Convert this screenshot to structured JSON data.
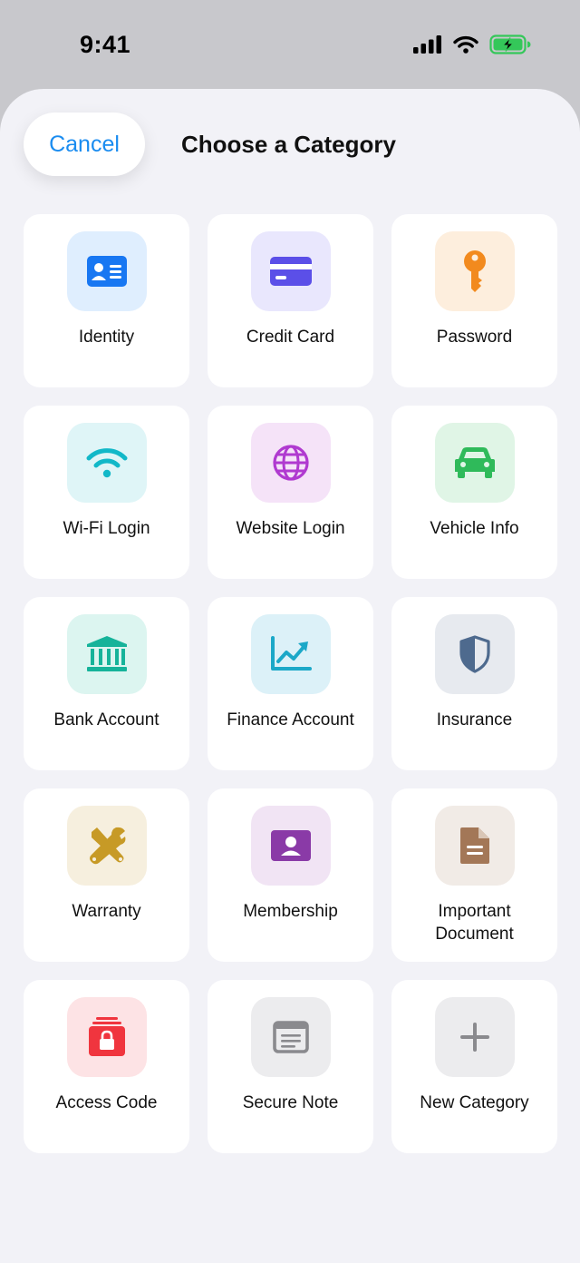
{
  "status": {
    "time": "9:41"
  },
  "header": {
    "cancel_label": "Cancel",
    "title": "Choose a Category"
  },
  "categories": [
    {
      "label": "Identity",
      "icon": "id-card-icon",
      "bg": "#dfeefe",
      "color": "#1877f2"
    },
    {
      "label": "Credit Card",
      "icon": "credit-card-icon",
      "bg": "#e9e7fd",
      "color": "#5b4fe8"
    },
    {
      "label": "Password",
      "icon": "key-icon",
      "bg": "#fdeedd",
      "color": "#f28a1e"
    },
    {
      "label": "Wi-Fi Login",
      "icon": "wifi-icon",
      "bg": "#dff5f7",
      "color": "#12b8c8"
    },
    {
      "label": "Website Login",
      "icon": "globe-icon",
      "bg": "#f5e3f8",
      "color": "#b03ad0"
    },
    {
      "label": "Vehicle Info",
      "icon": "car-icon",
      "bg": "#e0f5e6",
      "color": "#2fba5a"
    },
    {
      "label": "Bank Account",
      "icon": "bank-icon",
      "bg": "#dcf5f0",
      "color": "#16b39a"
    },
    {
      "label": "Finance Account",
      "icon": "chart-icon",
      "bg": "#dcf1f8",
      "color": "#1ba8c8"
    },
    {
      "label": "Insurance",
      "icon": "shield-icon",
      "bg": "#e7eaef",
      "color": "#4e6a8e"
    },
    {
      "label": "Warranty",
      "icon": "tools-icon",
      "bg": "#f6efde",
      "color": "#c79a26"
    },
    {
      "label": "Membership",
      "icon": "member-card-icon",
      "bg": "#f1e4f4",
      "color": "#8a3aa7"
    },
    {
      "label": "Important Document",
      "icon": "document-icon",
      "bg": "#f1ebe6",
      "color": "#a37757"
    },
    {
      "label": "Access Code",
      "icon": "lock-box-icon",
      "bg": "#fde3e5",
      "color": "#f0353e"
    },
    {
      "label": "Secure Note",
      "icon": "note-icon",
      "bg": "#ececee",
      "color": "#8a8a8e"
    },
    {
      "label": "New Category",
      "icon": "plus-icon",
      "bg": "#ececee",
      "color": "#8a8a8e"
    }
  ]
}
